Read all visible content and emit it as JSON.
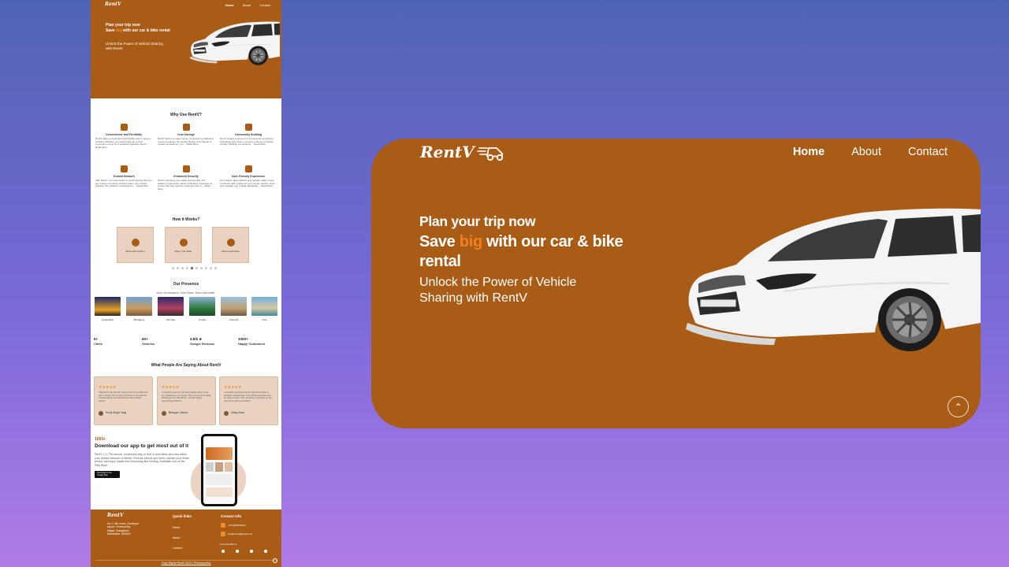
{
  "main": {
    "brand": "RentV",
    "nav": [
      "Home",
      "About",
      "Contact"
    ],
    "hero": {
      "line1": "Plan your trip now",
      "line2_pre": "Save ",
      "line2_highlight": "big",
      "line2_post": " with our car & bike rental",
      "line3": "Unlock the Power of Vehicle Sharing with RentV"
    },
    "scroll_top_icon": "double-chevron-up-icon",
    "colors": {
      "brand": "#a85c16",
      "accent": "#f47f1f"
    }
  },
  "preview": {
    "brand": "RentV",
    "nav": [
      "Home",
      "About",
      "Contact"
    ],
    "hero": {
      "line1": "Plan your trip now",
      "line2_pre": "Save ",
      "line2_highlight": "big",
      "line2_post": " with our car & bike rental",
      "line3": "Unlock the Power of Vehicle Sharing with RentV"
    },
    "why_title": "Why Use RentV?",
    "features": [
      {
        "title": "Convenience and Flexibility",
        "desc": "RentV offers a convenient and flexible way to access vehicles. Whether you need a bike for a short commute or a car for a weekend getaway, RentV ... Read More"
      },
      {
        "title": "Cost Savings",
        "desc": "RentV helps you save money compared to traditional rental companies. By renting directly from friends or trusted connections, you ... Read More"
      },
      {
        "title": "Community Building",
        "desc": "RentV fosters a sense of community by connecting individuals who share a common interest in vehicle sharing. Building connections ... Read More"
      },
      {
        "title": "Trusted Network",
        "desc": "With RentV, you have peace of mind knowing that you are renting or lending vehicles within your trusted network. Our platform is designed to ... Read More"
      },
      {
        "title": "Enhanced Security",
        "desc": "RentV prioritizes your safety and security. Our platform implements robust verification processes to ensure that only genuine users are part of ... Read More"
      },
      {
        "title": "User-Friendly Experience",
        "desc": "Our intuitive app interface and website make it easy to find the right vehicle for your needs. Search, book, and manage your rentals effortlessly ... Read More"
      }
    ],
    "how_title": "How it Works?",
    "steps": [
      "Book and Confirm",
      "Enjoy Your Ride",
      "Return and Rate"
    ],
    "presence_title": "Our Presence",
    "presence_sub": "More Destinations. More Ease. More Affordable.",
    "cities": [
      "Hyderabad",
      "Bangalore",
      "Mumbai",
      "Kerala",
      "Chennai",
      "Goa"
    ],
    "stats": [
      {
        "value": "6+",
        "label": "Cities"
      },
      {
        "value": "60+",
        "label": "Vehicles"
      },
      {
        "value": "4.8/5 ★",
        "label": "Google Reviews"
      },
      {
        "value": "1000+",
        "label": "Happy Customers"
      }
    ],
    "testimonials_title": "What People Are Saying About RentV",
    "testimonials": [
      {
        "stars": "★★★★★",
        "text": "Thanks to the RentV I can rent out my bike and earn money. It's so easy to book a car and the rentals will be at trusted personal vehicle rental...",
        "name": "Suraj Singh Negi"
      },
      {
        "stars": "★★★★★",
        "text": "I recently rented a car from RentV and it was an impressive. It's super easy to use and made booking a car effortless. I would highly recommend RentV.",
        "name": "Bhargav Varma"
      },
      {
        "stars": "★★★★★",
        "text": "I recently used the RentV app and it was a fantastic experience. The whole process was so easy to use, from booking to picking up the car at the pick up location.",
        "name": "Uday Kiran"
      }
    ],
    "app": {
      "count": "1000+",
      "heading": "Download our app to get most out of it",
      "desc": "RentV 1.0: The secure, convenient way to rent or lend bikes and cars within your trusted network of friends. Find the vehicle you need, choose your rental period, and enjoy hassle-free borrowing and lending. Available now on the Play Store.",
      "store": "Download on the Google Play"
    },
    "footer": {
      "brand": "RentV",
      "address": "No 1, 8th cross, Dodeppa layout, Rammurthy Nagar, Bangalore, Karnataka, 560016",
      "quick_links_title": "Quick links",
      "quick_links": [
        "Home",
        "About",
        "Contact"
      ],
      "contact_title": "Contact Info",
      "phone": "+91 9845012344",
      "email": "info@rentv@gmail.com",
      "connect": "Connect with us",
      "copyright": "Copy Rights RentV 2023 | Privacy policy"
    }
  }
}
